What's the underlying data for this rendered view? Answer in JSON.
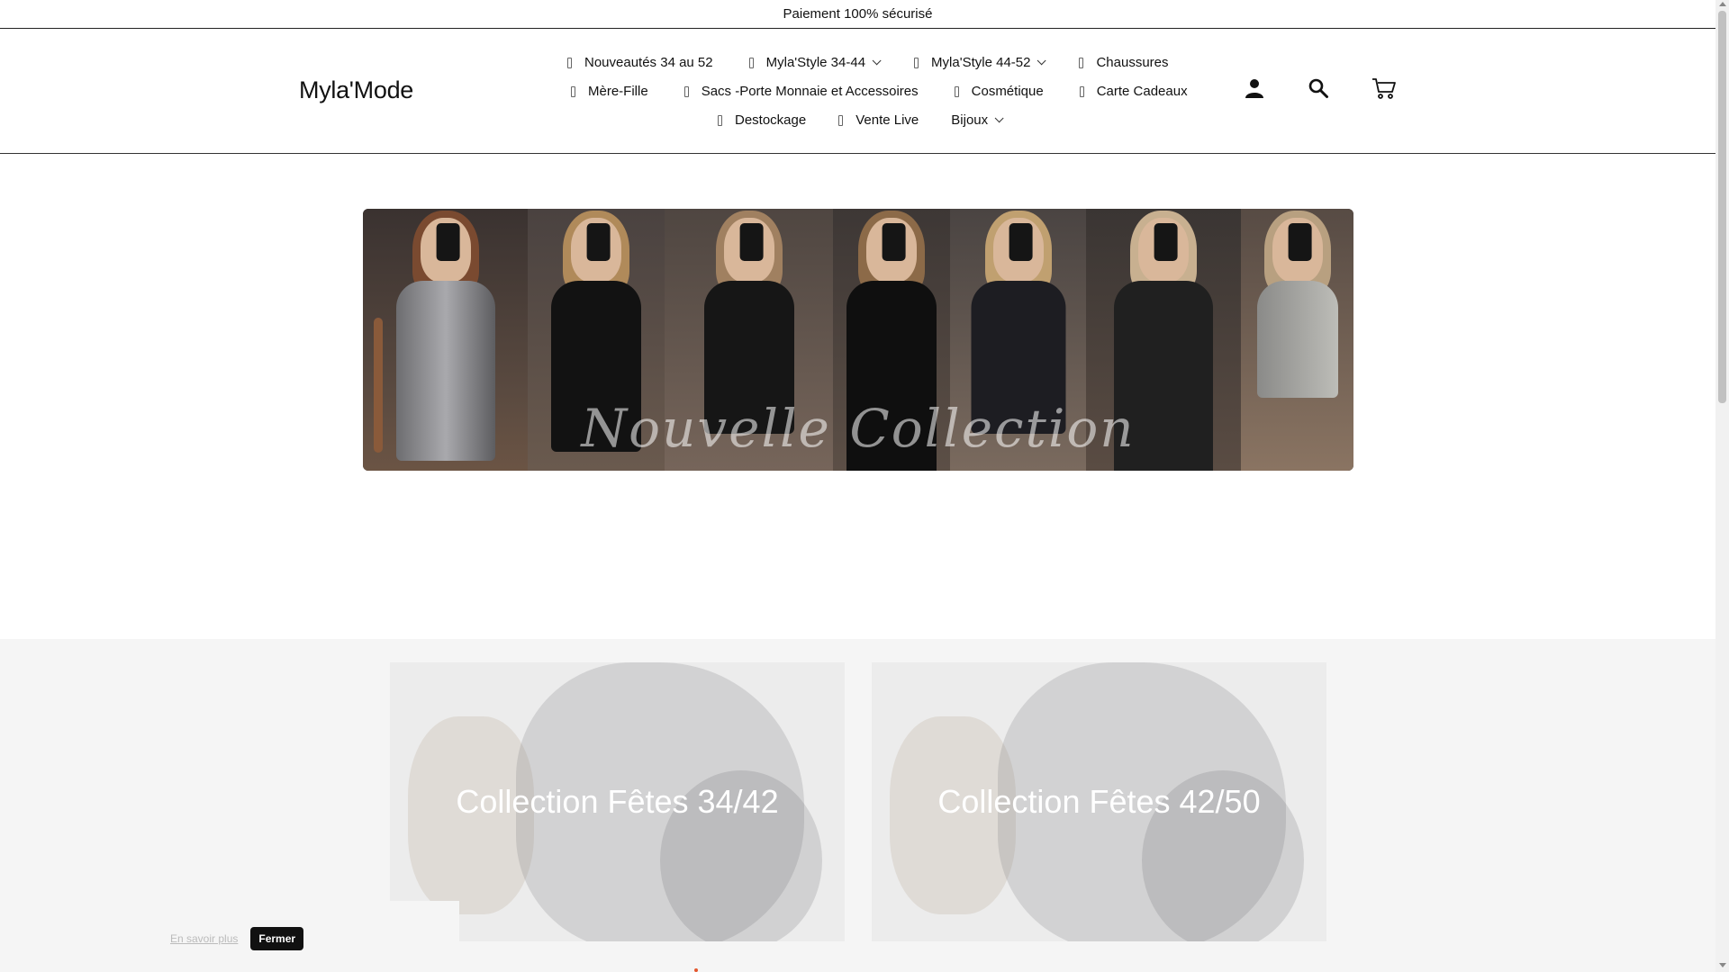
{
  "announcement": "Paiement 100% sécurisé",
  "brand": "Myla'Mode",
  "nav": {
    "row1": [
      {
        "label": "Nouveautés 34 au 52",
        "dropdown": false
      },
      {
        "label": "Myla'Style 34-44",
        "dropdown": true
      },
      {
        "label": "Myla'Style 44-52",
        "dropdown": true
      },
      {
        "label": "Chaussures",
        "dropdown": false
      }
    ],
    "row2": [
      {
        "label": "Mère-Fille",
        "dropdown": false
      },
      {
        "label": "Sacs -Porte Monnaie et Accessoires",
        "dropdown": false
      },
      {
        "label": "Cosmétique",
        "dropdown": false
      },
      {
        "label": "Carte Cadeaux",
        "dropdown": false
      }
    ],
    "row3": [
      {
        "label": "Destockage",
        "dropdown": false
      },
      {
        "label": "Vente Live",
        "dropdown": false
      },
      {
        "label": "Bijoux",
        "dropdown": true
      }
    ]
  },
  "header_icons": [
    "account-icon",
    "search-icon",
    "cart-icon"
  ],
  "hero": {
    "title": "Nouvelle Collection"
  },
  "collections": [
    {
      "title": "Collection Fêtes 34/42"
    },
    {
      "title": "Collection Fêtes 42/50"
    }
  ],
  "cookie_banner": {
    "learn_more": "En savoir plus",
    "close_label": "Fermer"
  },
  "colors": {
    "text": "#111111",
    "accent_dot": "#e4572e"
  }
}
